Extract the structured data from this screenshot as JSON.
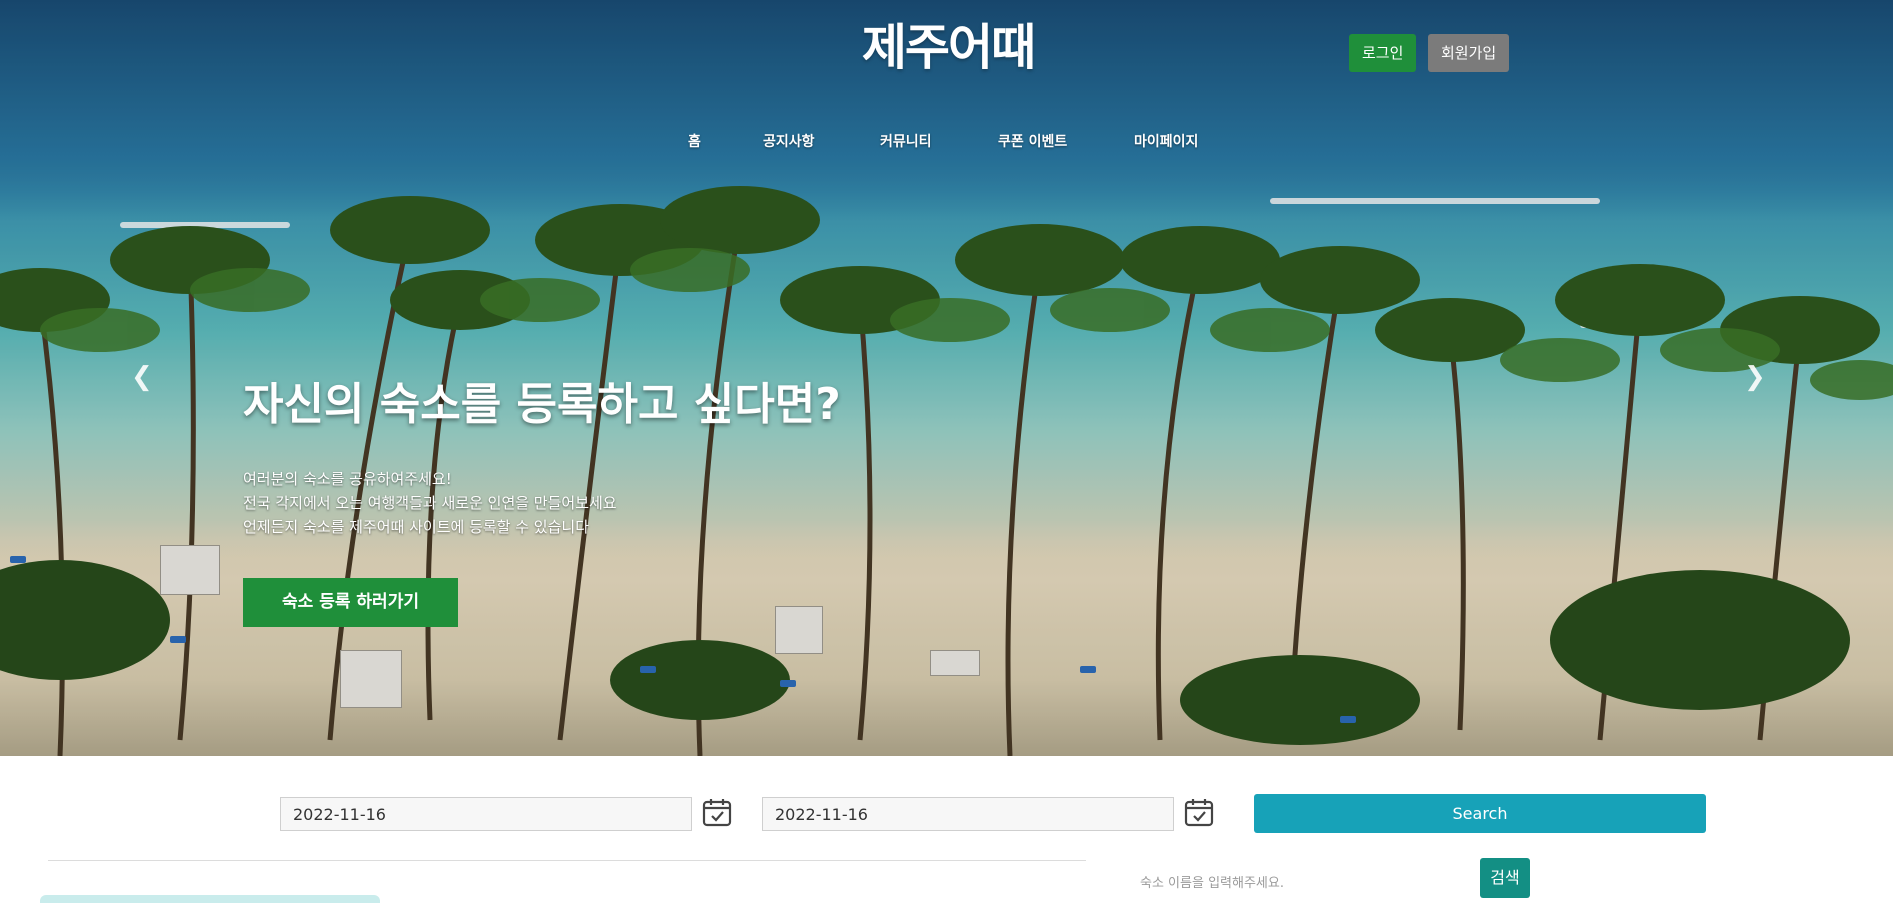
{
  "header": {
    "logo": "제주어때",
    "login_label": "로그인",
    "signup_label": "회원가입"
  },
  "nav": {
    "items": [
      {
        "label": "홈"
      },
      {
        "label": "공지사항"
      },
      {
        "label": "커뮤니티"
      },
      {
        "label": "쿠폰 이벤트"
      },
      {
        "label": "마이페이지"
      }
    ]
  },
  "hero": {
    "title": "자신의 숙소를 등록하고 싶다면?",
    "lines": [
      "여러분의 숙소를 공유하여주세요!",
      "전국 각지에서 오는 여행객들과 새로운 인연을 만들어보세요",
      "언제든지 숙소를 제주어때 사이트에 등록할 수 있습니다"
    ],
    "cta_label": "숙소 등록 하러가기",
    "prev_icon": "chevron-left-icon",
    "next_icon": "chevron-right-icon"
  },
  "search": {
    "checkin_value": "2022-11-16",
    "checkout_value": "2022-11-16",
    "calendar_icon": "calendar-check-icon",
    "search_label": "Search",
    "name_placeholder": "숙소 이름을 입력해주세요.",
    "small_search_label": "검색"
  },
  "colors": {
    "green": "#1f8f3a",
    "gray": "#7b7b7b",
    "teal": "#17a2b8",
    "dark_teal": "#138f84"
  }
}
